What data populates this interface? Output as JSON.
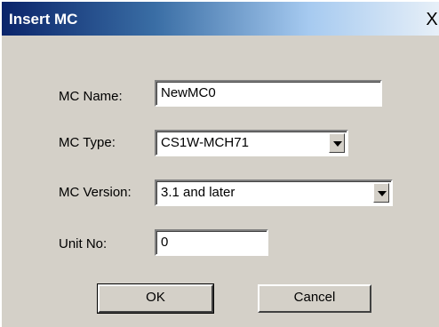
{
  "dialog": {
    "title": "Insert MC",
    "close_label": "X"
  },
  "form": {
    "mc_name_label": "MC Name:",
    "mc_name_value": "NewMC0",
    "mc_type_label": "MC Type:",
    "mc_type_value": "CS1W-MCH71",
    "mc_version_label": "MC Version:",
    "mc_version_value": "3.1 and later",
    "unit_no_label": "Unit No:",
    "unit_no_value": "0"
  },
  "buttons": {
    "ok_label": "OK",
    "cancel_label": "Cancel"
  },
  "icons": {
    "dropdown": "chevron-down-icon",
    "close": "close-icon"
  }
}
